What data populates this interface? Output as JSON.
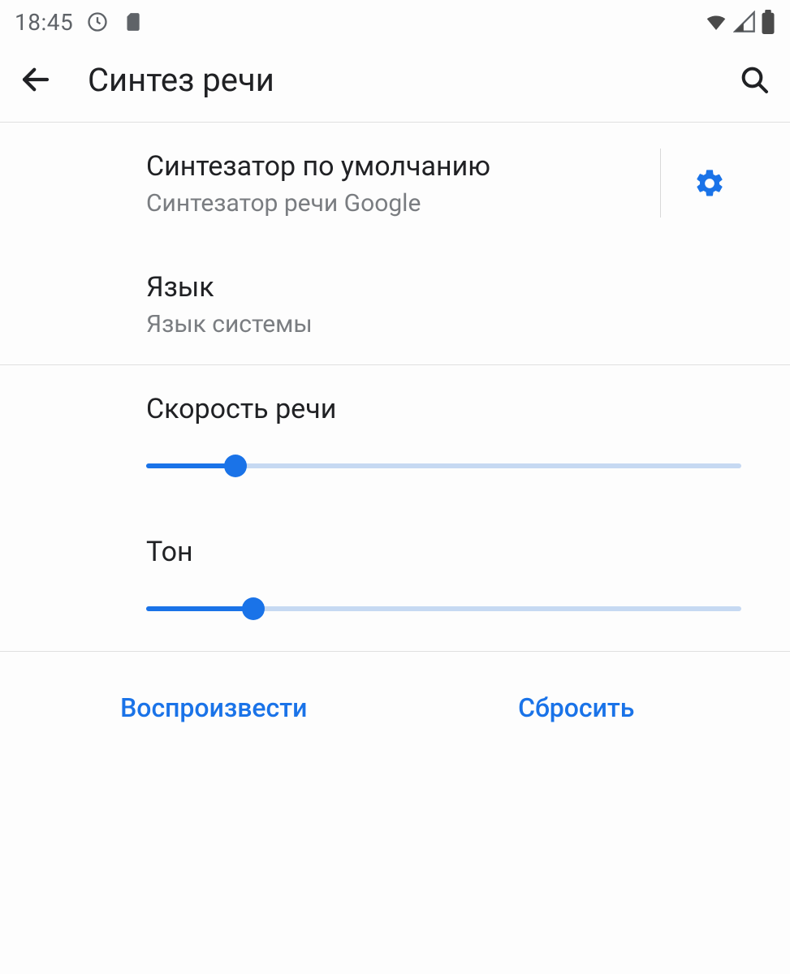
{
  "status_bar": {
    "time": "18:45",
    "icons": {
      "left": [
        "clock-outline-icon",
        "sd-card-icon"
      ],
      "right": [
        "wifi-icon",
        "cell-signal-icon",
        "battery-icon"
      ]
    }
  },
  "header": {
    "title": "Синтез речи"
  },
  "settings": {
    "engine": {
      "title": "Синтезатор по умолчанию",
      "subtitle": "Синтезатор речи Google"
    },
    "language": {
      "title": "Язык",
      "subtitle": "Язык системы"
    }
  },
  "sliders": {
    "rate": {
      "label": "Скорость речи",
      "value_percent": 15
    },
    "pitch": {
      "label": "Тон",
      "value_percent": 18
    }
  },
  "actions": {
    "play": "Воспроизвести",
    "reset": "Сбросить"
  },
  "colors": {
    "accent": "#1a73e8",
    "text_primary": "#202124",
    "text_secondary": "#7a7d81",
    "divider": "#e0e0e0",
    "slider_bg": "#c6d9f2"
  }
}
